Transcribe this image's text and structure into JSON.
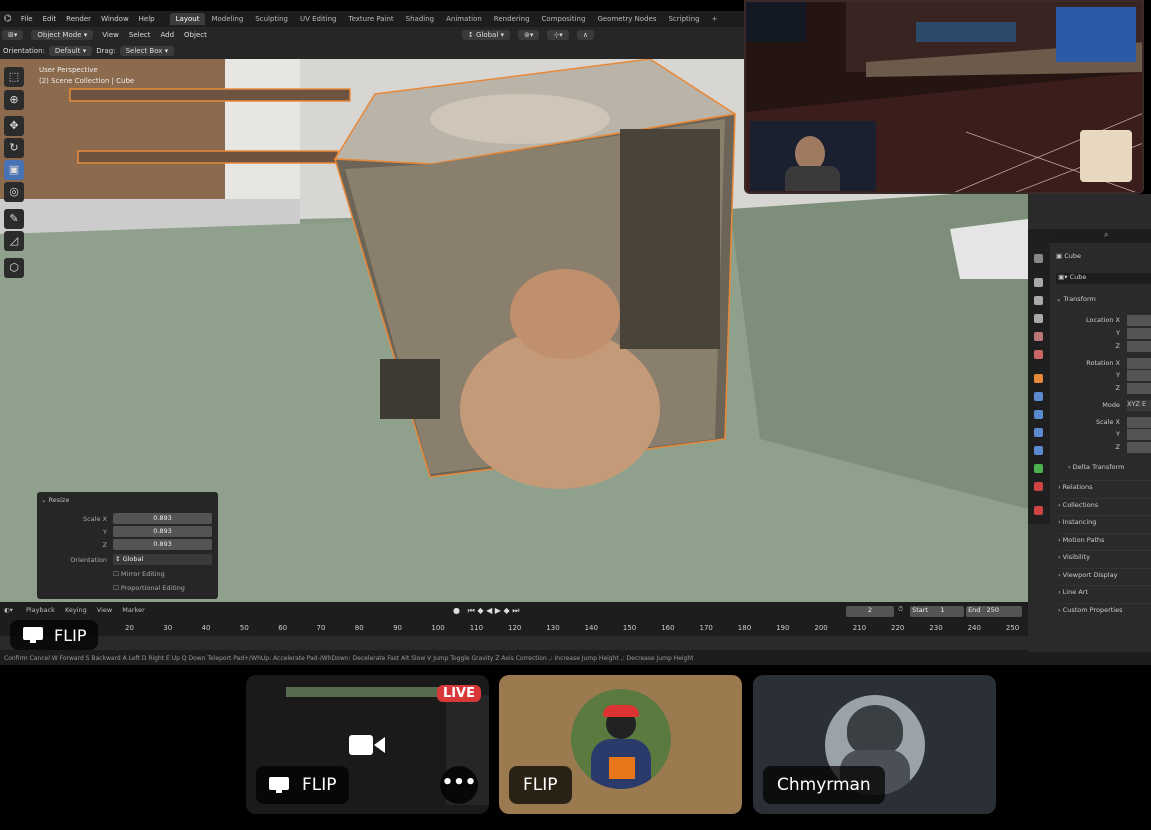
{
  "blender": {
    "menu": [
      "File",
      "Edit",
      "Render",
      "Window",
      "Help"
    ],
    "workspaces": [
      {
        "label": "Layout",
        "active": true
      },
      {
        "label": "Modeling"
      },
      {
        "label": "Sculpting"
      },
      {
        "label": "UV Editing"
      },
      {
        "label": "Texture Paint"
      },
      {
        "label": "Shading"
      },
      {
        "label": "Animation"
      },
      {
        "label": "Rendering"
      },
      {
        "label": "Compositing"
      },
      {
        "label": "Geometry Nodes"
      },
      {
        "label": "Scripting"
      }
    ],
    "add_tab": "+",
    "header": {
      "mode": "Object Mode",
      "menu": [
        "View",
        "Select",
        "Add",
        "Object"
      ],
      "transform_orientation": "Global"
    },
    "tool_header": {
      "orientation_label": "Orientation:",
      "orientation_value": "Default",
      "drag_label": "Drag:",
      "drag_value": "Select Box"
    },
    "viewport": {
      "perspective": "User Perspective",
      "collection": "(2) Scene Collection | Cube"
    },
    "resize_panel": {
      "title": "Resize",
      "scale_x_label": "Scale X",
      "y_label": "Y",
      "z_label": "Z",
      "scale_x": "0.893",
      "scale_y": "0.893",
      "scale_z": "0.893",
      "orientation_label": "Orientation",
      "orientation_value": "Global",
      "mirror_editing": "Mirror Editing",
      "proportional_editing": "Proportional Editing"
    },
    "properties": {
      "object_name": "Cube",
      "data_name": "Cube",
      "transform": "Transform",
      "location_x": "Location X",
      "y": "Y",
      "z": "Z",
      "rotation_x": "Rotation X",
      "mode_label": "Mode",
      "mode_value": "XYZ E",
      "scale_x": "Scale X",
      "delta_transform": "Delta Transform",
      "sections": [
        "Relations",
        "Collections",
        "Instancing",
        "Motion Paths",
        "Visibility",
        "Viewport Display",
        "Line Art",
        "Custom Properties"
      ]
    },
    "timeline": {
      "menu": [
        "Playback",
        "Keying",
        "View",
        "Marker"
      ],
      "current_frame": "2",
      "start_label": "Start",
      "start": "1",
      "end_label": "End",
      "end": "250",
      "ticks": [
        "20",
        "30",
        "40",
        "50",
        "60",
        "70",
        "80",
        "90",
        "100",
        "110",
        "120",
        "130",
        "140",
        "150",
        "160",
        "170",
        "180",
        "190",
        "200",
        "210",
        "220",
        "230",
        "240",
        "250"
      ]
    },
    "status_bar": "Confirm   Cancel   W Forward   S Backward   A Left   D Right   E Up   Q Down   Teleport   Pad+/WhUp: Accelerate   Pad-/WhDown: Decelerate   Fast   Alt Slow   V Jump   Toggle Gravity   Z Axis Correction   ,: Increase Jump Height   ,: Decrease Jump Height"
  },
  "screen_share_badge": {
    "label": "FLIP",
    "icon": "monitor-icon"
  },
  "participants": [
    {
      "name": "FLIP",
      "live": "LIVE",
      "type": "screen-share",
      "icon": "monitor-icon"
    },
    {
      "name": "FLIP",
      "type": "avatar",
      "bg": "#9b7a50"
    },
    {
      "name": "Chmyrman",
      "type": "avatar",
      "bg": "#2b2f36"
    }
  ],
  "colors": {
    "selection_orange": "#e8893a",
    "blender_blue": "#4772b3",
    "live_red": "#d93838"
  }
}
